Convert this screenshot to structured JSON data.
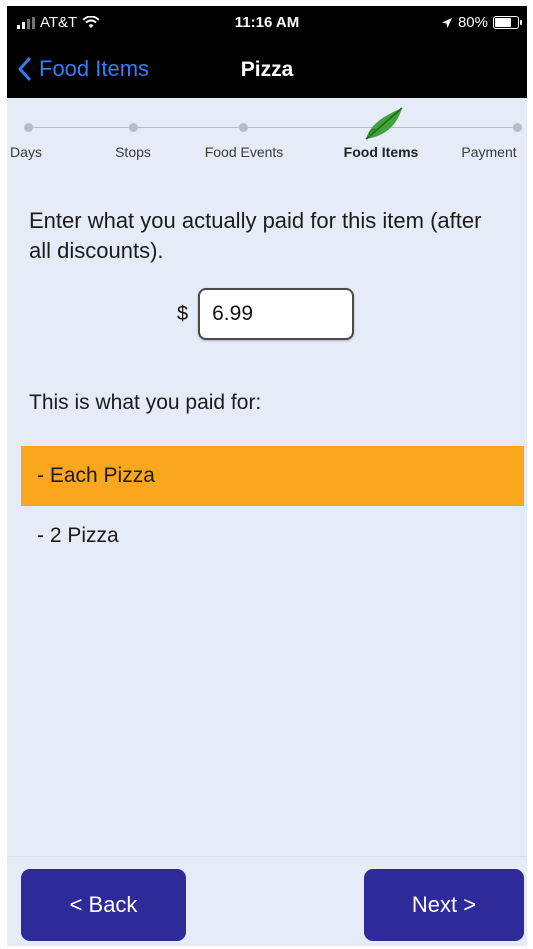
{
  "status_bar": {
    "carrier": "AT&T",
    "time": "11:16 AM",
    "battery": "80%",
    "battery_level": 0.8
  },
  "nav": {
    "back_label": "Food Items",
    "title": "Pizza"
  },
  "stepper": {
    "steps": [
      "Days",
      "Stops",
      "Food Events",
      "Food Items",
      "Payment"
    ],
    "active_step": "Food Items"
  },
  "form": {
    "prompt": "Enter what you actually paid for this item (after all discounts).",
    "currency_symbol": "$",
    "price_value": "6.99",
    "paid_for_label": "This is what you paid for:"
  },
  "options": [
    {
      "label": "- Each Pizza",
      "selected": true
    },
    {
      "label": "- 2 Pizza",
      "selected": false
    }
  ],
  "footer": {
    "back_button": "< Back",
    "next_button": "Next >"
  },
  "colors": {
    "accent": "#2e2a99",
    "selected_option": "#fba71d",
    "link": "#2f7ff8"
  },
  "icons": {
    "back": "chevron-left-icon",
    "wifi": "wifi-icon",
    "signal": "signal-bars-icon",
    "location": "location-arrow-icon",
    "battery": "battery-icon",
    "step_marker": "leaf-icon"
  }
}
